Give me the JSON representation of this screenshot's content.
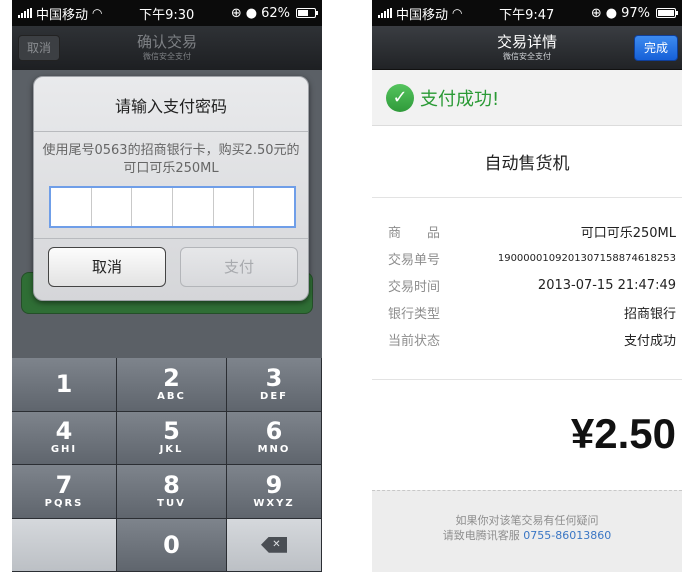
{
  "left": {
    "statusbar": {
      "carrier": "中国移动",
      "time": "下午9:30",
      "battery": "62%",
      "battery_level": 0.62
    },
    "navbar": {
      "cancel": "取消",
      "title": "确认交易",
      "subtitle": "微信安全支付"
    },
    "dialog": {
      "title": "请输入支付密码",
      "message": "使用尾号0563的招商银行卡，购买2.50元的可口可乐250ML",
      "password_cells": 6,
      "cancel": "取消",
      "pay": "支付"
    },
    "keypad": [
      {
        "num": "1",
        "letters": ""
      },
      {
        "num": "2",
        "letters": "ABC"
      },
      {
        "num": "3",
        "letters": "DEF"
      },
      {
        "num": "4",
        "letters": "GHI"
      },
      {
        "num": "5",
        "letters": "JKL"
      },
      {
        "num": "6",
        "letters": "MNO"
      },
      {
        "num": "7",
        "letters": "PQRS"
      },
      {
        "num": "8",
        "letters": "TUV"
      },
      {
        "num": "9",
        "letters": "WXYZ"
      },
      {
        "num": "0",
        "letters": ""
      }
    ],
    "delete_icon": "backspace-icon"
  },
  "right": {
    "statusbar": {
      "carrier": "中国移动",
      "time": "下午9:47",
      "battery": "97%",
      "battery_level": 0.97
    },
    "navbar": {
      "title": "交易详情",
      "subtitle": "微信安全支付",
      "done": "完成"
    },
    "success": "支付成功!",
    "merchant": "自动售货机",
    "details": [
      {
        "label": "商　　品",
        "value": "可口可乐250ML"
      },
      {
        "label": "交易单号",
        "value": "1900000109201307158874618253"
      },
      {
        "label": "交易时间",
        "value": "2013-07-15 21:47:49"
      },
      {
        "label": "银行类型",
        "value": "招商银行"
      },
      {
        "label": "当前状态",
        "value": "支付成功"
      }
    ],
    "amount": "¥2.50",
    "footer": {
      "line1": "如果你对该笔交易有任何疑问",
      "line2_prefix": "请致电腾讯客服",
      "phone": "0755-86013860"
    }
  },
  "colors": {
    "success_green": "#2a9a35",
    "done_blue": "#1660d8",
    "link_blue": "#3a76c4"
  }
}
